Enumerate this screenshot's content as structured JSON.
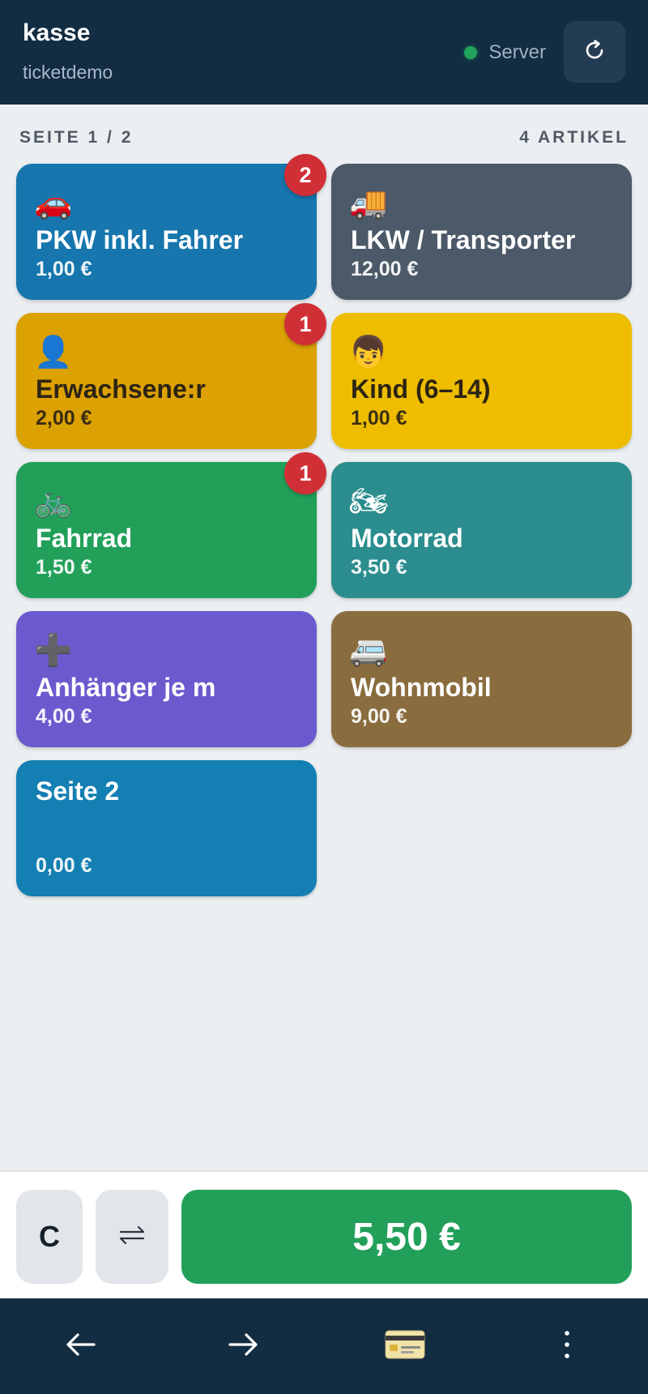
{
  "header": {
    "title": "kasse",
    "subtitle": "ticketdemo",
    "server_label": "Server",
    "server_status_color": "#22a35b",
    "refresh_icon": "refresh-icon"
  },
  "meta": {
    "page_label": "SEITE 1 / 2",
    "article_count": "4 ARTIKEL"
  },
  "tiles": [
    {
      "icon": "🚗",
      "name": "PKW inkl. Fahrer",
      "price": "1,00 €",
      "badge": "2",
      "color": "#1676ad"
    },
    {
      "icon": "🚚",
      "name": "LKW / Transporter",
      "price": "12,00 €",
      "badge": "",
      "color": "#4b5968"
    },
    {
      "icon": "👤",
      "name": "Erwachsene:r",
      "price": "2,00 €",
      "badge": "1",
      "color": "#dca103"
    },
    {
      "icon": "👦",
      "name": "Kind (6–14)",
      "price": "1,00 €",
      "badge": "",
      "color": "#eebd00"
    },
    {
      "icon": "🚲",
      "name": "Fahrrad",
      "price": "1,50 €",
      "badge": "1",
      "color": "#22a05a"
    },
    {
      "icon": "🏍",
      "name": "Motorrad",
      "price": "3,50 €",
      "badge": "",
      "color": "#2b8d8d"
    },
    {
      "icon": "➕",
      "name": "Anhänger je m",
      "price": "4,00 €",
      "badge": "",
      "color": "#6b5acd"
    },
    {
      "icon": "🚐",
      "name": "Wohnmobil",
      "price": "9,00 €",
      "badge": "",
      "color": "#8a6d3e"
    },
    {
      "icon": "",
      "name": "Seite 2",
      "price": "0,00 €",
      "badge": "",
      "color": "#137fb2"
    }
  ],
  "bottom": {
    "clear_label": "C",
    "swap_icon": "swap-arrows-icon",
    "total_label": "5,50 €"
  },
  "nav": {
    "items": [
      "back-arrow-icon",
      "forward-arrow-icon",
      "credit-card-icon",
      "more-vertical-icon"
    ]
  }
}
